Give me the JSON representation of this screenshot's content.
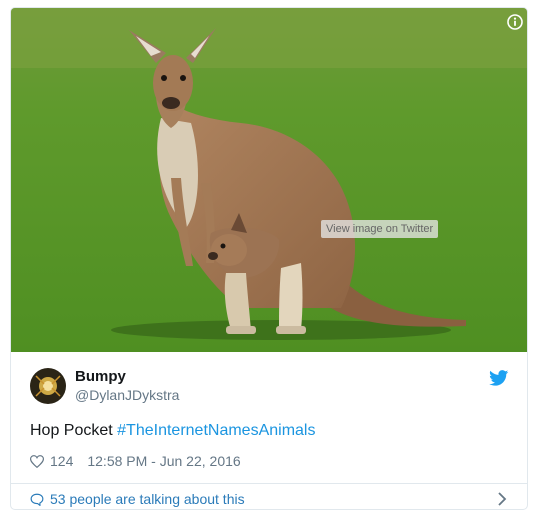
{
  "media": {
    "view_button_label": "View image on Twitter",
    "info_icon": "info-icon"
  },
  "tweet": {
    "author_name": "Bumpy",
    "author_handle": "@DylanJDykstra",
    "text_plain": "Hop Pocket ",
    "hashtag": "#TheInternetNamesAnimals",
    "like_count": "124",
    "timestamp": "12:58 PM - Jun 22, 2016",
    "talking_label": "53 people are talking about this"
  },
  "colors": {
    "link": "#1b95e0",
    "talk_link": "#2b7bb9",
    "secondary_text": "#657786",
    "primary_text": "#14171a",
    "twitter_blue": "#1da1f2",
    "border": "#e1e8ed"
  }
}
